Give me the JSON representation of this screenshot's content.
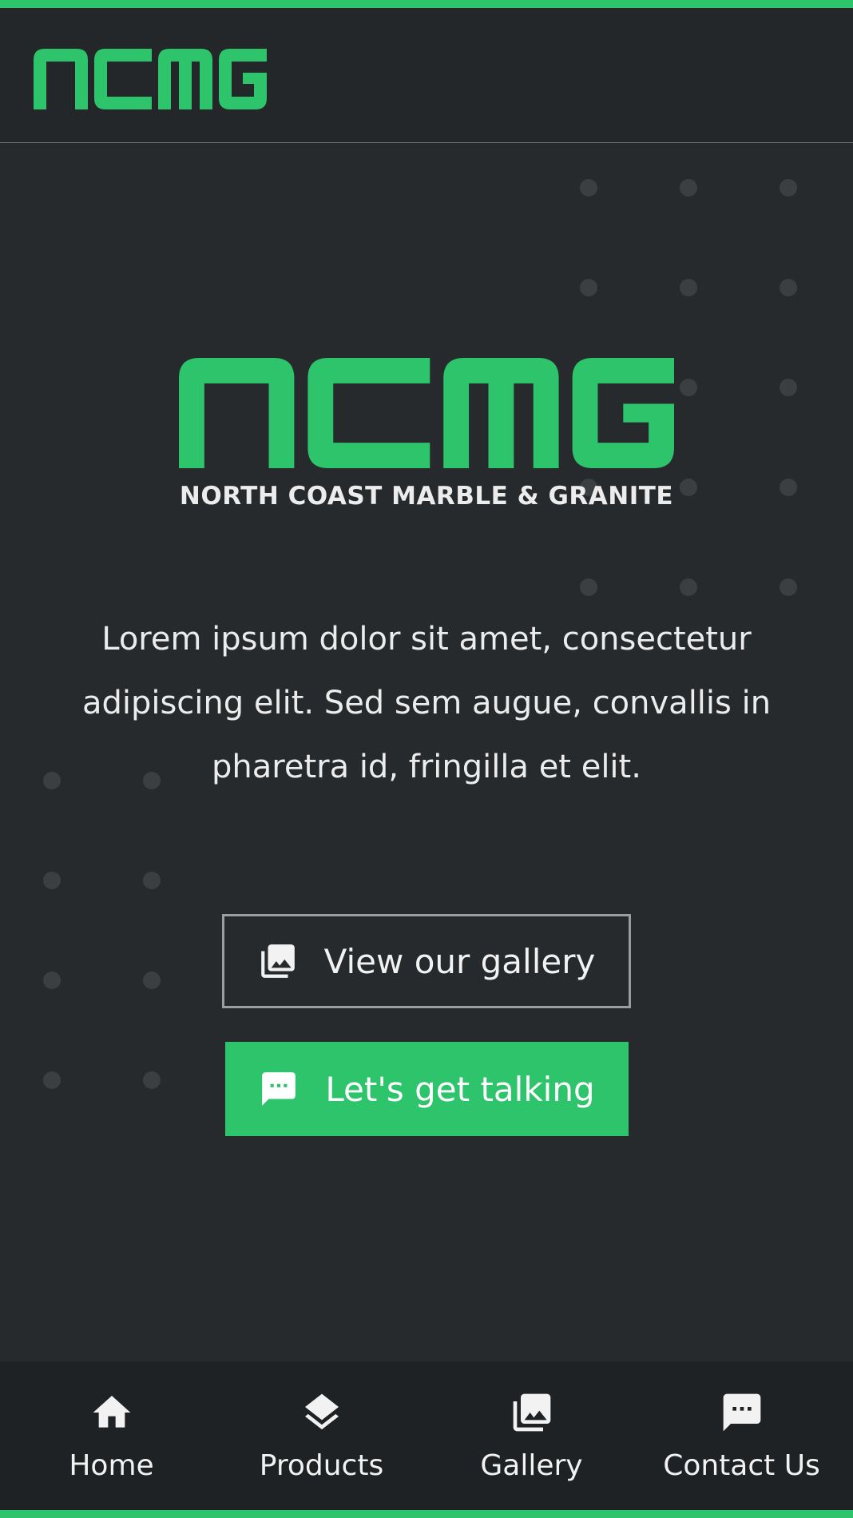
{
  "brand": {
    "logo_text": "ncmg",
    "tagline": "NORTH COAST MARBLE & GRANITE",
    "accent_color": "#2dc46b",
    "background_color": "#262a2c"
  },
  "hero": {
    "description": "Lorem ipsum dolor sit amet, consectetur adipiscing elit. Sed sem augue, convallis in pharetra id, fringilla et elit."
  },
  "buttons": {
    "gallery": {
      "label": "View our gallery",
      "icon": "gallery-icon"
    },
    "talk": {
      "label": "Let's get talking",
      "icon": "chat-icon"
    }
  },
  "bottom_nav": {
    "items": [
      {
        "label": "Home",
        "icon": "home-icon"
      },
      {
        "label": "Products",
        "icon": "layers-icon"
      },
      {
        "label": "Gallery",
        "icon": "gallery-icon"
      },
      {
        "label": "Contact Us",
        "icon": "chat-icon"
      }
    ]
  }
}
